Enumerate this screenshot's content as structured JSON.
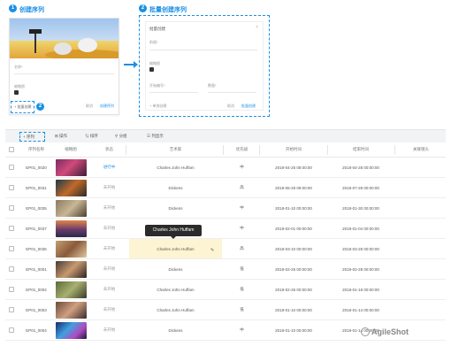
{
  "steps": {
    "create": {
      "number": "1",
      "title": "创建序列"
    },
    "batch": {
      "number": "2",
      "title": "批量创建序列"
    },
    "toolbar_step": "1",
    "button_step": "2"
  },
  "card1": {
    "field_name": "名称*",
    "field_thumbnail": "缩略图",
    "batch_button": "+ 批量创建",
    "cancel": "取消",
    "create": "创建序列"
  },
  "batch_dialog": {
    "title": "批量创建",
    "close": "×",
    "prefix_label": "前缀*",
    "thumb_label": "缩略图",
    "start_label": "开始编号*",
    "count_label": "数量*",
    "add_button": "+ 单独创建",
    "cancel": "取消",
    "submit": "批量创建"
  },
  "toolbar": {
    "new": "+ 序列",
    "items": [
      {
        "icon": "⊞",
        "label": "操作"
      },
      {
        "icon": "⇅",
        "label": "排序"
      },
      {
        "icon": "⚲",
        "label": "分组"
      },
      {
        "icon": "☰",
        "label": "列显示"
      }
    ]
  },
  "table": {
    "headers": [
      "序列名称",
      "缩略图",
      "状态",
      "艺术家",
      "优先级",
      "开始时间",
      "结束时间",
      "关联镜头"
    ],
    "rows": [
      {
        "name": "EP01_0020",
        "status": "进行中",
        "artist": "Charles John Huffam",
        "priority": "中",
        "start": "2018-04-25 08:00:00",
        "end": "2018-04-28 00:00:00"
      },
      {
        "name": "EP01_0031",
        "status": "未开始",
        "artist": "Dickens",
        "priority": "高",
        "start": "2018-06-28 09:00:00",
        "end": "2018-07-28 00:00:00"
      },
      {
        "name": "EP01_0035",
        "status": "未开始",
        "artist": "Dickens",
        "priority": "中",
        "start": "2018-01-10 00:00:00",
        "end": "2018-01-30 00:00:00"
      },
      {
        "name": "EP01_0037",
        "status": "未开始",
        "artist": "",
        "priority": "中",
        "start": "2018-02-01 00:00:00",
        "end": "2018-01-04 00:00:00"
      },
      {
        "name": "EP01_0036",
        "status": "未开始",
        "artist": "Charles John Huffam",
        "priority": "高",
        "start": "2018-03-10 00:00:00",
        "end": "2018-03-28 00:00:00"
      },
      {
        "name": "EP01_0001",
        "status": "未开始",
        "artist": "Dickens",
        "priority": "低",
        "start": "2018-02-26 00:00:00",
        "end": "2018-02-28 00:00:00"
      },
      {
        "name": "EP01_0002",
        "status": "未开始",
        "artist": "Charles John Huffam",
        "priority": "低",
        "start": "2018-02-26 00:00:00",
        "end": "2018-01-18 00:00:00"
      },
      {
        "name": "EP01_0003",
        "status": "未开始",
        "artist": "Charles John Huffam",
        "priority": "低",
        "start": "2018-01-10 00:00:00",
        "end": "2018-01-14 00:00:00"
      },
      {
        "name": "EP01_0004",
        "status": "未开始",
        "artist": "Dickens",
        "priority": "中",
        "start": "2018-01-10 00:00:00",
        "end": "2018-01-14 00:00:00"
      }
    ]
  },
  "tooltip": "Charles John Huffam",
  "watermark": "AgileShot",
  "colors": {
    "accent": "#1b8fe6",
    "highlight": "#fdf4d3"
  }
}
